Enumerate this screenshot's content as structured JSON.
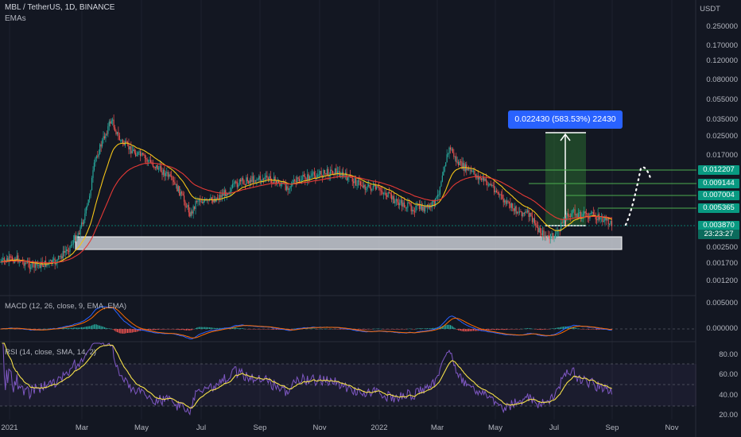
{
  "header": {
    "symbol_title": "MBL / TetherUS, 1D, BINANCE",
    "indicator": "EMAs",
    "currency": "USDT"
  },
  "price_axis": [
    "0.250000",
    "0.170000",
    "0.120000",
    "0.080000",
    "0.055000",
    "0.035000",
    "0.025000",
    "0.017000",
    "0.002500",
    "0.001700",
    "0.001200"
  ],
  "level_tags": [
    {
      "label": "0.012207",
      "color": "#089981"
    },
    {
      "label": "0.009144",
      "color": "#089981"
    },
    {
      "label": "0.007004",
      "color": "#089981"
    },
    {
      "label": "0.005365",
      "color": "#089981"
    },
    {
      "label": "0.003870",
      "color": "#089981"
    },
    {
      "label": "23:23:27",
      "color": "#089981"
    }
  ],
  "measure_label": "0.022430 (583.53%) 22430",
  "macd": {
    "title": "MACD (12, 26, close, 9, EMA, EMA)",
    "axis": [
      "0.005000",
      "0.000000"
    ]
  },
  "rsi": {
    "title": "RSI (14, close, SMA, 14, 2)",
    "axis": [
      "80.00",
      "60.00",
      "40.00",
      "20.00"
    ]
  },
  "time_axis": [
    "2021",
    "Mar",
    "May",
    "Jul",
    "Sep",
    "Nov",
    "2022",
    "Mar",
    "May",
    "Jul",
    "Sep",
    "Nov"
  ],
  "colors": {
    "background": "#131722",
    "up": "#26a69a",
    "down": "#ef5350",
    "ema_fast": "#f5c518",
    "ema_slow": "#e53935",
    "rsi_line": "#7e57c2",
    "rsi_ma": "#f5e04a",
    "zone": "#9598a1",
    "measure": "#2962ff",
    "green_level": "#4caf50"
  }
}
